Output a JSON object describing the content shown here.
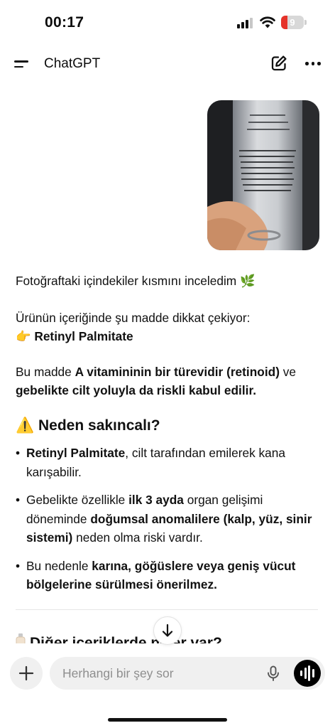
{
  "status_bar": {
    "time": "00:17",
    "battery_level": "9",
    "battery_color": "#e5332a"
  },
  "nav": {
    "title": "ChatGPT",
    "menu_icon": "hamburger-menu-icon",
    "new_chat_icon": "edit-icon",
    "more_icon": "ellipsis-icon"
  },
  "conversation": {
    "user_message": {
      "attachment": "photo-icon"
    },
    "assistant_message": {
      "intro": "Fotoğraftaki içindekiler kısmını inceledim 🌿",
      "notice": "Ürünün içeriğinde şu madde dikkat çekiyor:",
      "highlight_emoji": "👉",
      "highlight_ingredient": "Retinyl Palmitate",
      "body_pre": "Bu madde ",
      "body_bold_1": "A vitamininin bir türevidir (retinoid)",
      "body_mid": " ve",
      "body_bold_2": "gebelikte cilt yoluyla da riskli kabul edilir.",
      "warning_heading_emoji": "⚠️",
      "warning_heading": "Neden sakıncalı?",
      "bullets": [
        {
          "b1": "Retinyl Palmitate",
          "t1": ", cilt tarafından emilerek kana karışabilir."
        },
        {
          "t1": "Gebelikte özellikle ",
          "b1": "ilk 3 ayda",
          "t2": " organ gelişimi döneminde ",
          "b2": "doğumsal anomalilere (kalp, yüz, sinir sistemi)",
          "t3": " neden olma riski vardır."
        },
        {
          "t1": "Bu nedenle ",
          "b1": "karına, göğüslere veya geniş vücut bölgelerine sürülmesi önerilmez."
        }
      ],
      "next_heading": "Diğer içeriklerde neler var?"
    }
  },
  "scroll_down_icon": "arrow-down-icon",
  "composer": {
    "placeholder": "Herhangi bir şey sor",
    "value": "",
    "plus_icon": "plus-icon",
    "mic_icon": "microphone-icon",
    "voice_icon": "voice-mode-icon"
  }
}
